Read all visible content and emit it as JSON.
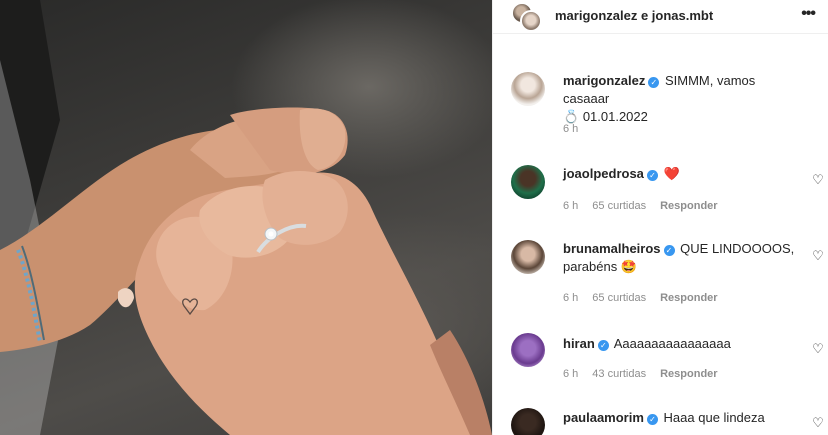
{
  "header": {
    "title": "marigonzalez e jonas.mbt",
    "more_icon": "more-options-icon"
  },
  "caption": {
    "username": "marigonzalez",
    "text": "SIMMM, vamos casaaar",
    "ring_emoji": "💍",
    "date": "01.01.2022",
    "time": "6 h"
  },
  "comments": [
    {
      "username": "joaolpedrosa",
      "text": "❤️",
      "time": "6 h",
      "likes": "65 curtidas",
      "reply": "Responder"
    },
    {
      "username": "brunamalheiros",
      "text": "QUE LINDOOOOS, parabéns 🤩",
      "time": "6 h",
      "likes": "65 curtidas",
      "reply": "Responder"
    },
    {
      "username": "hiran",
      "text": "Aaaaaaaaaaaaaaaa",
      "time": "6 h",
      "likes": "43 curtidas",
      "reply": "Responder"
    },
    {
      "username": "paulaamorim",
      "text": "Haaa que lindeza"
    }
  ],
  "verified_mark": "✓",
  "like_glyph": "♡",
  "colors": {
    "verified": "#3897f0",
    "meta_text": "#8e8e8e",
    "heart": "#e0245e"
  }
}
